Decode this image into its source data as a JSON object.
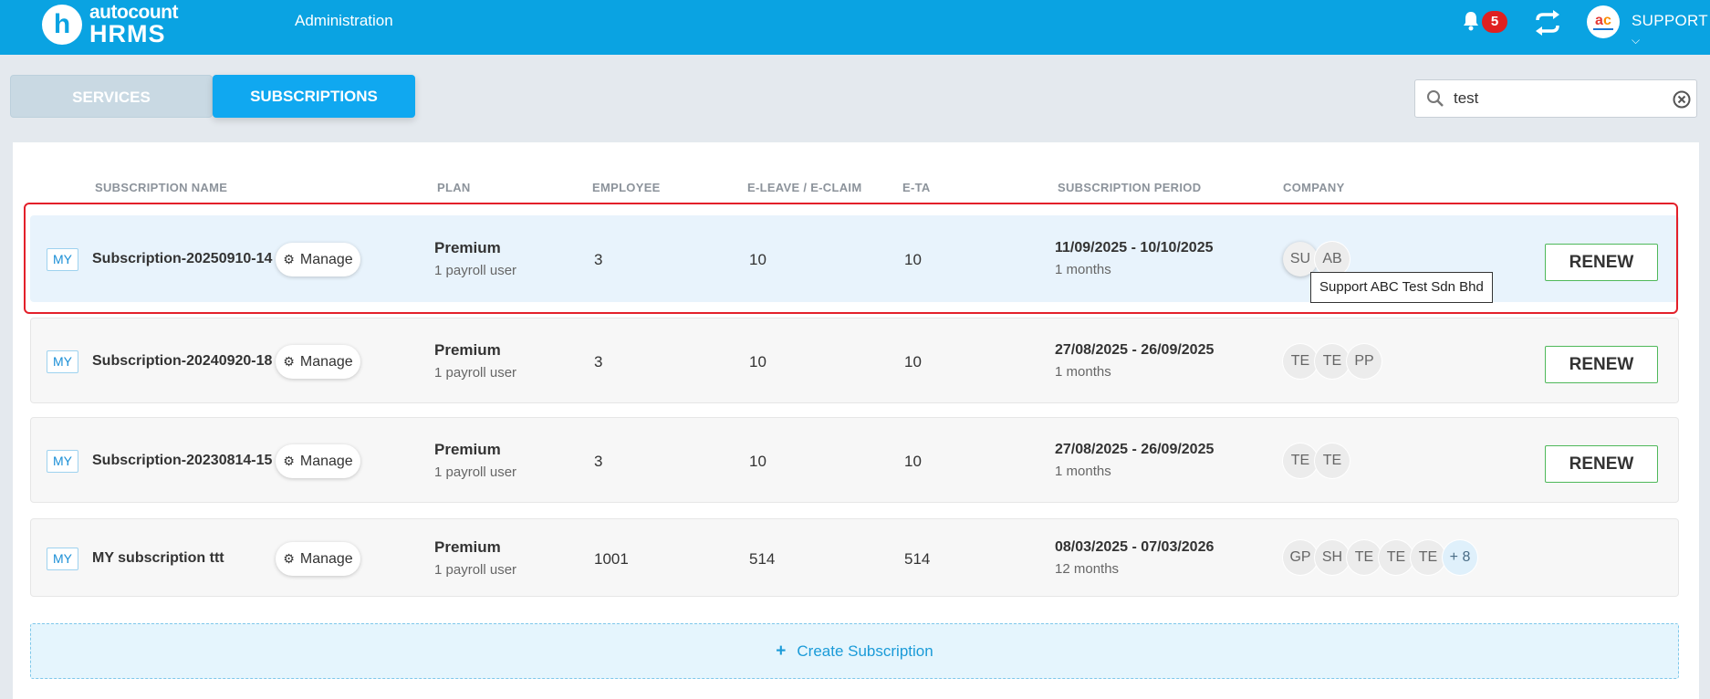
{
  "header": {
    "logo_top": "autocount",
    "logo_bottom": "HRMS",
    "logo_letter": "h",
    "nav_title": "Administration",
    "notification_count": "5",
    "user_label": "SUPPORT",
    "icons": [
      "bell-icon",
      "sync-icon",
      "user-avatar",
      "chevron-down-icon"
    ],
    "brand_color": "#0aa3e2"
  },
  "tabs": [
    {
      "label": "SERVICES",
      "active": false
    },
    {
      "label": "SUBSCRIPTIONS",
      "active": true
    }
  ],
  "search": {
    "value": "test",
    "placeholder": ""
  },
  "columns": [
    "SUBSCRIPTION NAME",
    "PLAN",
    "EMPLOYEE",
    "E-LEAVE / E-CLAIM",
    "E-TA",
    "SUBSCRIPTION PERIOD",
    "COMPANY"
  ],
  "manage_label": "Manage",
  "renew_label": "RENEW",
  "rows": [
    {
      "country": "MY",
      "name": "Subscription-20250910-14",
      "plan": "Premium",
      "plan_detail": "1 payroll user",
      "employee": "3",
      "eleave_eclaim": "10",
      "eta": "10",
      "period": "11/09/2025 - 10/10/2025",
      "duration": "1 months",
      "companies": [
        "SU",
        "AB"
      ],
      "more": "",
      "renew": true,
      "selected": true
    },
    {
      "country": "MY",
      "name": "Subscription-20240920-18",
      "plan": "Premium",
      "plan_detail": "1 payroll user",
      "employee": "3",
      "eleave_eclaim": "10",
      "eta": "10",
      "period": "27/08/2025 - 26/09/2025",
      "duration": "1 months",
      "companies": [
        "TE",
        "TE",
        "PP"
      ],
      "more": "",
      "renew": true,
      "selected": false
    },
    {
      "country": "MY",
      "name": "Subscription-20230814-15",
      "plan": "Premium",
      "plan_detail": "1 payroll user",
      "employee": "3",
      "eleave_eclaim": "10",
      "eta": "10",
      "period": "27/08/2025 - 26/09/2025",
      "duration": "1 months",
      "companies": [
        "TE",
        "TE"
      ],
      "more": "",
      "renew": true,
      "selected": false
    },
    {
      "country": "MY",
      "name": "MY subscription ttt",
      "plan": "Premium",
      "plan_detail": "1 payroll user",
      "employee": "1001",
      "eleave_eclaim": "514",
      "eta": "514",
      "period": "08/03/2025 - 07/03/2026",
      "duration": "12 months",
      "companies": [
        "GP",
        "SH",
        "TE",
        "TE",
        "TE"
      ],
      "more": "+ 8",
      "renew": false,
      "selected": false
    }
  ],
  "tooltip": "Support ABC Test Sdn Bhd",
  "create_label": "Create Subscription"
}
